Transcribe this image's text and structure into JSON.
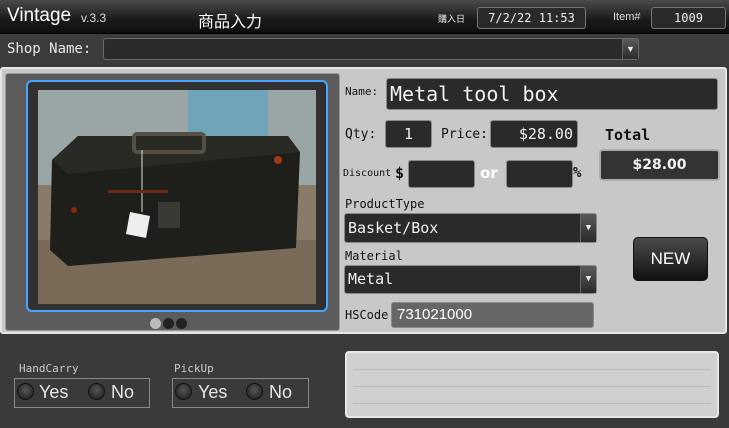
{
  "titlebar": {
    "app_name": "Vintage",
    "version": "v.3.3",
    "screen_title": "商品入力",
    "date_label": "購入日",
    "date_value": "7/2/22 11:53",
    "item_label": "Item#",
    "item_value": "1009"
  },
  "shop": {
    "label": "Shop Name:",
    "value": ""
  },
  "photo": {
    "description_icon": "photo-of-tool-box",
    "pages": 3,
    "current_page": 1
  },
  "form": {
    "name_label": "Name:",
    "name_value": "Metal tool box",
    "qty_label": "Qty:",
    "qty_value": "1",
    "price_label": "Price:",
    "price_value": "$28.00",
    "total_label": "Total",
    "total_value": "$28.00",
    "discount_label": "Discount",
    "discount_currency": "$",
    "discount_amount": "",
    "or_label": "or",
    "discount_percent": "",
    "percent_sign": "%",
    "product_type_label": "ProductType",
    "product_type_value": "Basket/Box",
    "material_label": "Material",
    "material_value": "Metal",
    "hscode_label": "HSCode",
    "hscode_value": "731021000",
    "new_button": "NEW"
  },
  "handcarry": {
    "label": "HandCarry",
    "yes": "Yes",
    "no": "No"
  },
  "pickup": {
    "label": "PickUp",
    "yes": "Yes",
    "no": "No"
  },
  "notes": {
    "value": ""
  },
  "colors": {
    "accent": "#4aa3ff",
    "panel": "#c8c8c8",
    "field": "#2a2a2a"
  }
}
